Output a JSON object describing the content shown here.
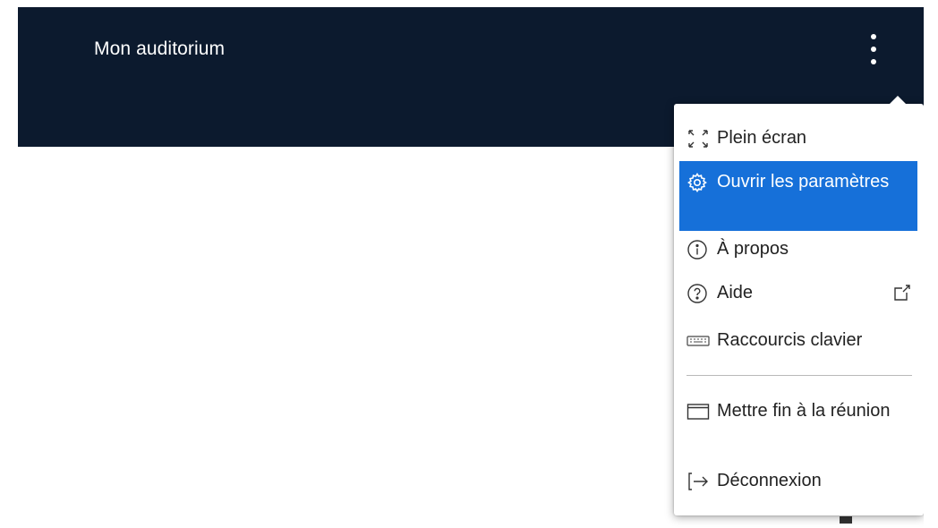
{
  "header": {
    "title": "Mon auditorium",
    "more_icon": "kebab-vertical-icon"
  },
  "menu": {
    "items": [
      {
        "label": "Plein écran",
        "icon": "fullscreen-icon"
      },
      {
        "label": "Ouvrir les paramètres",
        "icon": "gear-icon",
        "highlighted": true
      },
      {
        "label": "À propos",
        "icon": "info-icon"
      },
      {
        "label": "Aide",
        "icon": "help-icon",
        "trailing_icon": "external-link-icon"
      },
      {
        "label": "Raccourcis clavier",
        "icon": "keyboard-icon"
      },
      {
        "label": "Mettre fin à la réunion",
        "icon": "window-icon"
      },
      {
        "label": "Déconnexion",
        "icon": "logout-icon"
      }
    ]
  },
  "colors": {
    "header_bg": "#0c1a2e",
    "highlight": "#1670d9"
  }
}
